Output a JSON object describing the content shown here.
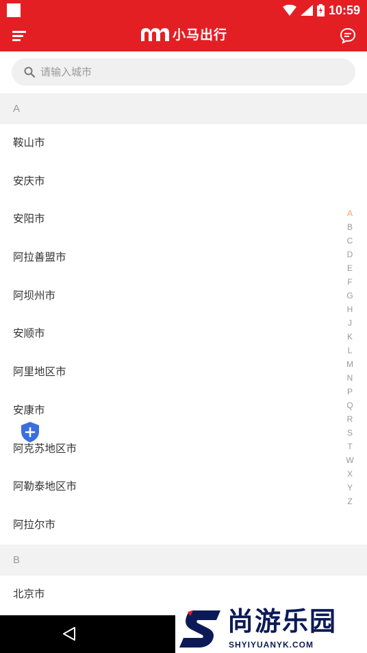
{
  "status_bar": {
    "time": "10:59"
  },
  "app_bar": {
    "brand": "小马出行"
  },
  "search": {
    "placeholder": "请输入城市"
  },
  "sections": {
    "a": {
      "letter": "A",
      "cities": [
        "鞍山市",
        "安庆市",
        "安阳市",
        "阿拉善盟市",
        "阿坝州市",
        "安顺市",
        "阿里地区市",
        "安康市",
        "阿克苏地区市",
        "阿勒泰地区市",
        "阿拉尔市"
      ]
    },
    "b": {
      "letter": "B",
      "cities": [
        "北京市"
      ]
    }
  },
  "index_letters": [
    "A",
    "B",
    "C",
    "D",
    "E",
    "F",
    "G",
    "H",
    "J",
    "K",
    "L",
    "M",
    "N",
    "P",
    "Q",
    "R",
    "S",
    "T",
    "W",
    "X",
    "Y",
    "Z"
  ],
  "active_index": "A",
  "colors": {
    "brand_red": "#e41f24",
    "index_active": "#f6a06a",
    "fab_blue": "#3b6fe0",
    "watermark_navy": "#0b1a57"
  },
  "watermark": {
    "title": "尚游乐园",
    "subtitle": "SHYIYUANYK.COM"
  }
}
